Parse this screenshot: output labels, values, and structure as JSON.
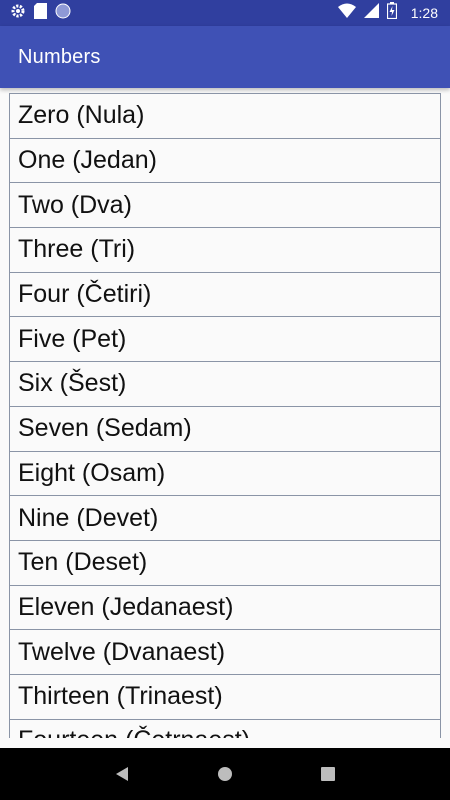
{
  "status_bar": {
    "time": "1:28",
    "icons_left": [
      "gear-icon",
      "sd-card-icon",
      "circle-icon"
    ],
    "icons_right": [
      "wifi-icon",
      "signal-icon",
      "battery-icon"
    ]
  },
  "app_bar": {
    "title": "Numbers"
  },
  "list": {
    "items": [
      "Zero (Nula)",
      "One (Jedan)",
      "Two (Dva)",
      "Three (Tri)",
      "Four (Četiri)",
      "Five (Pet)",
      "Six (Šest)",
      "Seven (Sedam)",
      "Eight (Osam)",
      "Nine (Devet)",
      "Ten (Deset)",
      "Eleven (Jedanaest)",
      "Twelve (Dvanaest)",
      "Thirteen (Trinaest)",
      "Fourteen (Četrnaest)"
    ]
  },
  "nav_bar": {
    "buttons": [
      "back-icon",
      "home-icon",
      "recents-icon"
    ]
  },
  "colors": {
    "primary": "#3f51b5",
    "primary_dark": "#303f9f",
    "item_border": "#8a94a6"
  }
}
